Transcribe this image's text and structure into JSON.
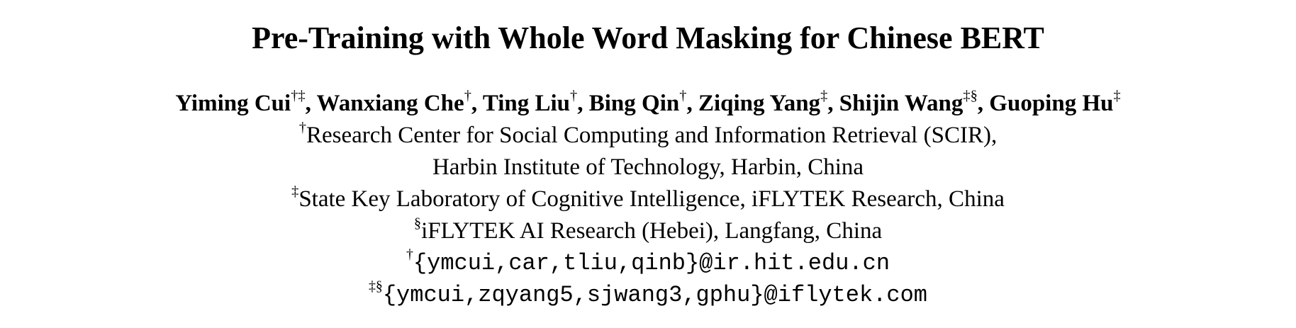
{
  "title": "Pre-Training with Whole Word Masking for Chinese BERT",
  "authors": [
    {
      "name": "Yiming Cui",
      "marks": "†‡",
      "sep": ", "
    },
    {
      "name": "Wanxiang Che",
      "marks": "†",
      "sep": ", "
    },
    {
      "name": "Ting Liu",
      "marks": "†",
      "sep": ", "
    },
    {
      "name": "Bing Qin",
      "marks": "†",
      "sep": ", "
    },
    {
      "name": "Ziqing Yang",
      "marks": "‡",
      "sep": ", "
    },
    {
      "name": "Shijin Wang",
      "marks": "‡§",
      "sep": ", "
    },
    {
      "name": "Guoping Hu",
      "marks": "‡",
      "sep": ""
    }
  ],
  "affiliations": [
    {
      "mark": "†",
      "text": "Research Center for Social Computing and Information Retrieval (SCIR),"
    },
    {
      "mark": "",
      "text": "Harbin Institute of Technology, Harbin, China"
    },
    {
      "mark": "‡",
      "text": "State Key Laboratory of Cognitive Intelligence, iFLYTEK Research, China"
    },
    {
      "mark": "§",
      "text": "iFLYTEK AI Research (Hebei), Langfang, China"
    }
  ],
  "emails": [
    {
      "mark": "†",
      "text": "{ymcui,car,tliu,qinb}@ir.hit.edu.cn"
    },
    {
      "mark": "‡§",
      "text": "{ymcui,zqyang5,sjwang3,gphu}@iflytek.com"
    }
  ]
}
